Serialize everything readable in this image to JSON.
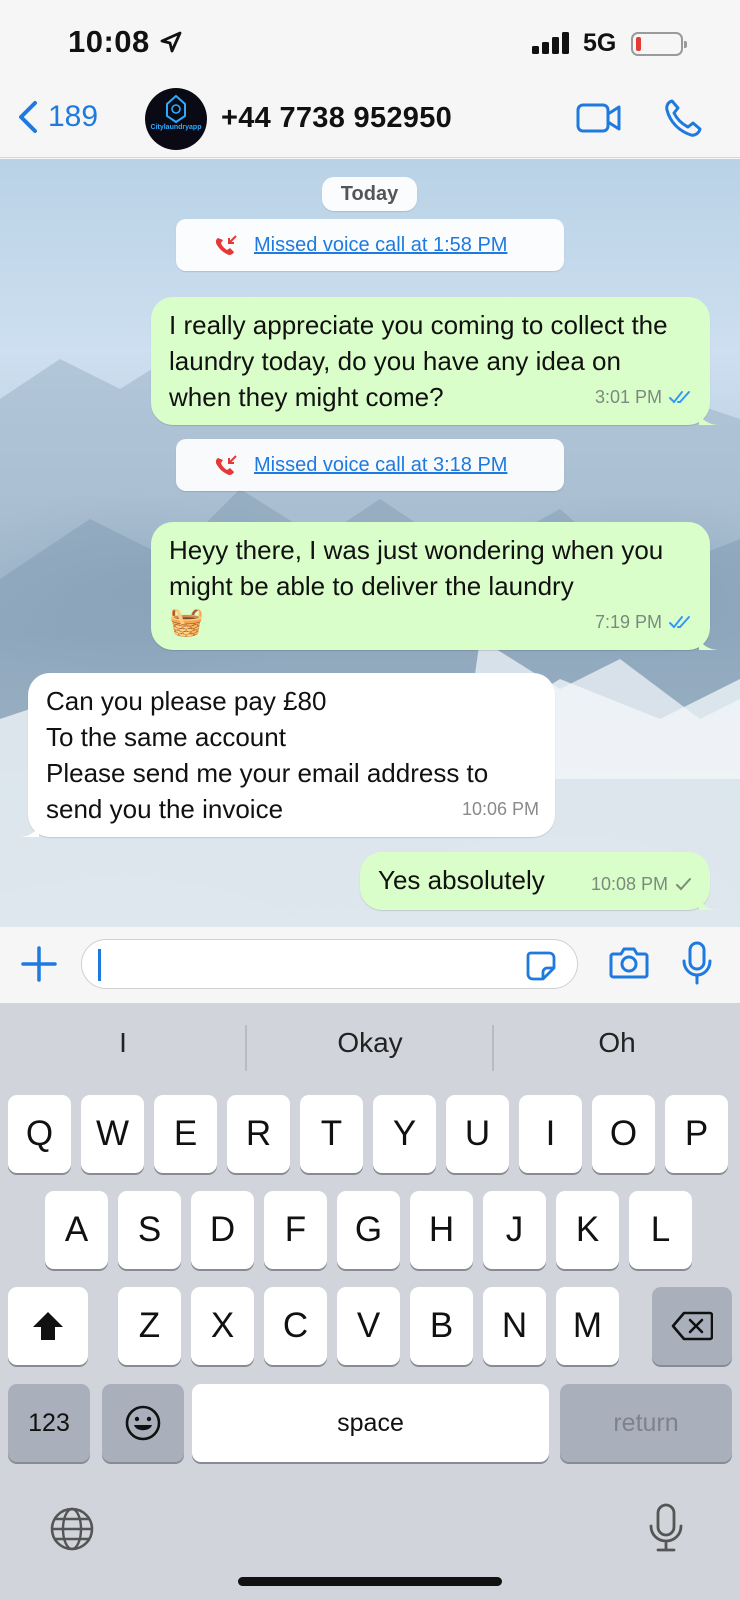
{
  "status_bar": {
    "time": "10:08",
    "network": "5G",
    "battery_level_percent": 10,
    "battery_color": "#e53935"
  },
  "header": {
    "back_count": "189",
    "avatar_brand": "Citylaundryapp",
    "contact_name": "+44 7738 952950",
    "icons": [
      "chevron-left-icon",
      "video-call-icon",
      "phone-icon"
    ]
  },
  "chat": {
    "date_label": "Today",
    "missed_call_1": "Missed voice call at 1:58 PM",
    "msg1": {
      "text": "I really appreciate you coming to collect the laundry today, do you have any idea on when they might come?",
      "time": "3:01 PM",
      "status": "read"
    },
    "missed_call_2": "Missed voice call at 3:18 PM",
    "msg2": {
      "text": "Heyy there, I was just wondering when you might be able to deliver the laundry",
      "emoji": "🧺",
      "time": "7:19 PM",
      "status": "read"
    },
    "msg3": {
      "line1": "Can you please pay £80",
      "line2": "To the same account",
      "line3": "Please send me your email address to",
      "line4": "send you the invoice",
      "time": "10:06 PM"
    },
    "msg4": {
      "text": "Yes absolutely",
      "time": "10:08 PM",
      "status": "sent"
    },
    "colors": {
      "outgoing_bubble": "#dafec9",
      "incoming_bubble": "#ffffff",
      "link": "#1f7ae0",
      "read_ticks": "#3497f9"
    }
  },
  "input": {
    "value": "",
    "icons": [
      "plus-icon",
      "sticker-icon",
      "camera-icon",
      "microphone-icon"
    ]
  },
  "keyboard": {
    "suggestions": [
      "I",
      "Okay",
      "Oh"
    ],
    "row1": [
      "Q",
      "W",
      "E",
      "R",
      "T",
      "Y",
      "U",
      "I",
      "O",
      "P"
    ],
    "row2": [
      "A",
      "S",
      "D",
      "F",
      "G",
      "H",
      "J",
      "K",
      "L"
    ],
    "row3": [
      "Z",
      "X",
      "C",
      "V",
      "B",
      "N",
      "M"
    ],
    "numbers_key": "123",
    "space_key": "space",
    "return_key": "return"
  }
}
